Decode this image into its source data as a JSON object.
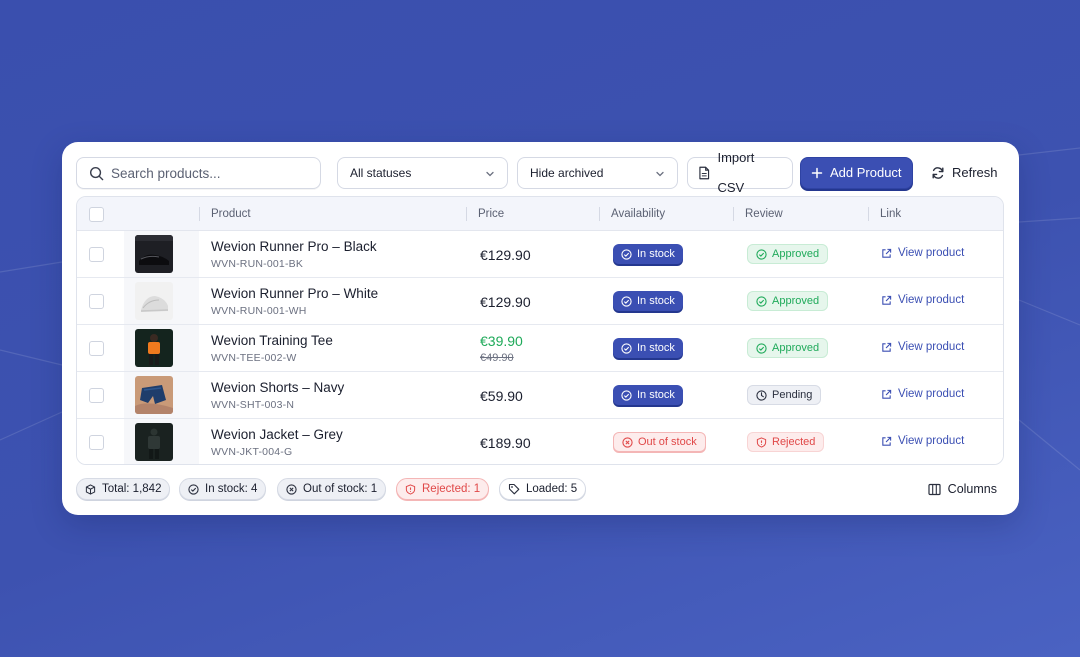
{
  "toolbar": {
    "search_placeholder": "Search products...",
    "status_filter": "All statuses",
    "archive_filter": "Hide archived",
    "import_label": "Import CSV",
    "add_label": "Add Product",
    "refresh_label": "Refresh"
  },
  "table": {
    "headers": [
      "Product",
      "Price",
      "Availability",
      "Review",
      "Link"
    ],
    "rows": [
      {
        "name": "Wevion Runner Pro – Black",
        "sku": "WVN-RUN-001-BK",
        "price": "€129.90",
        "old_price": "",
        "availability": "In stock",
        "review": "Approved",
        "link": "View product"
      },
      {
        "name": "Wevion Runner Pro – White",
        "sku": "WVN-RUN-001-WH",
        "price": "€129.90",
        "old_price": "",
        "availability": "In stock",
        "review": "Approved",
        "link": "View product"
      },
      {
        "name": "Wevion Training Tee",
        "sku": "WVN-TEE-002-W",
        "price": "€39.90",
        "old_price": "€49.90",
        "availability": "In stock",
        "review": "Approved",
        "link": "View product"
      },
      {
        "name": "Wevion Shorts – Navy",
        "sku": "WVN-SHT-003-N",
        "price": "€59.90",
        "old_price": "",
        "availability": "In stock",
        "review": "Pending",
        "link": "View product"
      },
      {
        "name": "Wevion Jacket – Grey",
        "sku": "WVN-JKT-004-G",
        "price": "€189.90",
        "old_price": "",
        "availability": "Out of stock",
        "review": "Rejected",
        "link": "View product"
      }
    ]
  },
  "footer": {
    "total": "Total: 1,842",
    "in_stock": "In stock: 4",
    "out_of_stock": "Out of stock: 1",
    "rejected": "Rejected: 1",
    "loaded": "Loaded: 5",
    "columns_label": "Columns"
  },
  "colors": {
    "accent": "#3b4fb3",
    "success": "#1faa5a",
    "danger": "#e04848",
    "background": "#3d52b0"
  }
}
